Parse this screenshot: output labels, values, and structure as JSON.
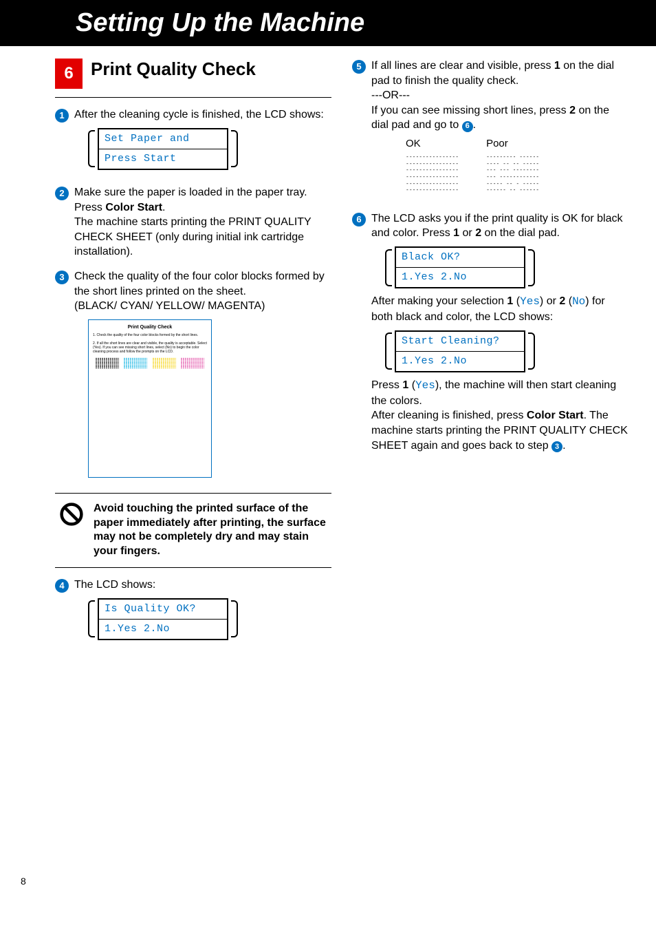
{
  "header": {
    "title": "Setting Up the Machine"
  },
  "section": {
    "number": "6",
    "title": "Print Quality Check"
  },
  "steps": {
    "s1": {
      "text": "After the cleaning cycle is finished, the LCD shows:",
      "lcd": {
        "line1": "Set Paper and",
        "line2": "Press Start"
      }
    },
    "s2": {
      "text1": "Make sure the paper is loaded in the paper tray.",
      "text2a": "Press ",
      "text2b": "Color Start",
      "text2c": ".",
      "text3": "The machine starts printing the PRINT QUALITY CHECK SHEET (only during initial ink cartridge installation)."
    },
    "s3": {
      "text1": "Check the quality of the four color blocks formed by the short lines printed on the sheet.",
      "text2": "(BLACK/ CYAN/ YELLOW/ MAGENTA)",
      "sheet": {
        "title": "Print Quality Check",
        "bullet1": "1. Check the quality of the four color blocks formed by the short lines.",
        "bullet2": "2. If all the short lines are clear and visible, the quality is acceptable. Select (Yes). If you can see missing short lines, select (No) to begin the color cleaning process and follow the prompts on the LCD."
      }
    },
    "warning": {
      "text": "Avoid touching the printed surface of the paper immediately after printing, the surface may not be completely dry and may stain your fingers."
    },
    "s4": {
      "text": "The LCD shows:",
      "lcd": {
        "line1": "Is Quality OK?",
        "line2": "1.Yes 2.No"
      }
    },
    "s5": {
      "p1a": "If all lines are clear and visible, press ",
      "p1b": "1",
      "p1c": " on the dial pad to finish the quality check.",
      "or": "---OR---",
      "p2a": "If you can see missing short lines, press ",
      "p2b": "2",
      "p2c": " on the dial pad and go to ",
      "p2d": ".",
      "ok_label": "OK",
      "poor_label": "Poor",
      "ok_rows": [
        "----------------",
        "----------------",
        "----------------",
        "----------------",
        "----------------",
        "----------------"
      ],
      "poor_rows": [
        "--------- ------",
        "---- -- -- -----",
        "--- --- --------",
        "--- ------------",
        "----- -- - -----",
        "------ -- ------"
      ]
    },
    "s6": {
      "p1a": "The LCD asks you if the print quality is OK for black and color. Press ",
      "p1b": "1",
      "p1c": " or ",
      "p1d": "2",
      "p1e": " on the dial pad.",
      "lcd1": {
        "line1": "Black OK?",
        "line2": "1.Yes 2.No"
      },
      "p2a": "After making your selection ",
      "p2b": "1",
      "p2c": " (",
      "p2yes": "Yes",
      "p2d": ") or ",
      "p2e": "2",
      "p2f": " (",
      "p2no": "No",
      "p2g": ") for both black and color, the LCD shows:",
      "lcd2": {
        "line1": "Start Cleaning?",
        "line2": "1.Yes 2.No"
      },
      "p3a": "Press ",
      "p3b": "1",
      "p3c": " (",
      "p3yes": "Yes",
      "p3d": "), the machine will then start cleaning the colors.",
      "p4a": "After cleaning is finished, press ",
      "p4b": "Color Start",
      "p4c": ". The machine starts printing the PRINT QUALITY CHECK SHEET again and goes back to step ",
      "p4d": "."
    }
  },
  "pagenum": "8"
}
